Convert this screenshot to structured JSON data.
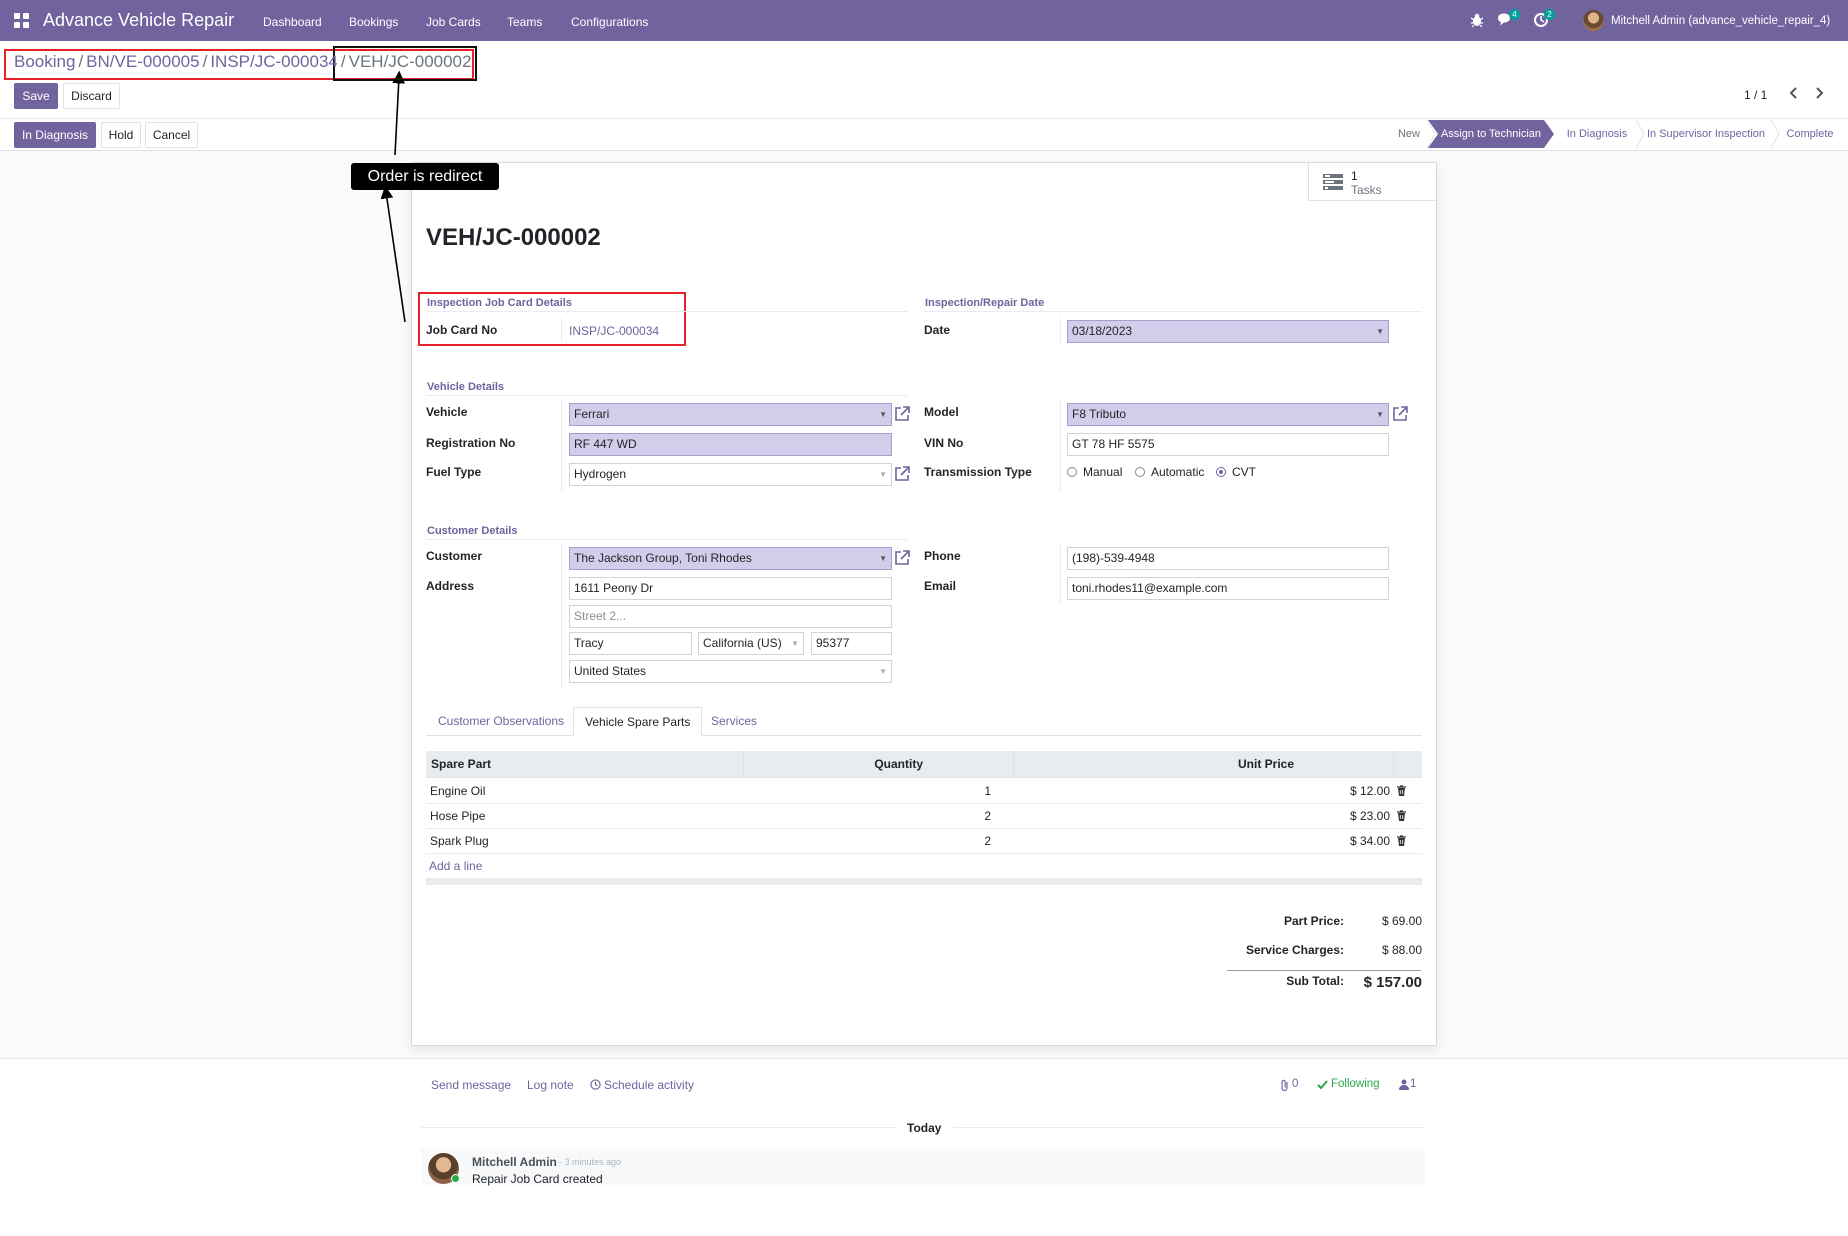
{
  "navbar": {
    "app_name": "Advance Vehicle Repair",
    "menu": [
      "Dashboard",
      "Bookings",
      "Job Cards",
      "Teams",
      "Configurations"
    ],
    "messages_badge": "4",
    "activities_badge": "2",
    "user": "Mitchell Admin (advance_vehicle_repair_4)"
  },
  "breadcrumb": {
    "items": [
      "Booking",
      "BN/VE-000005",
      "INSP/JC-000034"
    ],
    "current": "VEH/JC-000002"
  },
  "buttons": {
    "save": "Save",
    "discard": "Discard"
  },
  "pager": {
    "value": "1 / 1"
  },
  "actions": {
    "in_diagnosis": "In Diagnosis",
    "hold": "Hold",
    "cancel": "Cancel"
  },
  "stages": [
    "New",
    "Assign to Technician",
    "In Diagnosis",
    "In Supervisor Inspection",
    "Complete"
  ],
  "active_stage": "Assign to Technician",
  "annotation": {
    "tooltip": "Order is redirect"
  },
  "smart_button": {
    "count": "1",
    "label": "Tasks"
  },
  "record": {
    "title": "VEH/JC-000002",
    "inspection_group": "Inspection Job Card Details",
    "job_card_label": "Job Card No",
    "job_card_value": "INSP/JC-000034",
    "date_group": "Inspection/Repair Date",
    "date_label": "Date",
    "date_value": "03/18/2023",
    "vehicle_group": "Vehicle Details",
    "vehicle_label": "Vehicle",
    "vehicle_value": "Ferrari",
    "model_label": "Model",
    "model_value": "F8 Tributo",
    "reg_label": "Registration No",
    "reg_value": "RF 447 WD",
    "vin_label": "VIN No",
    "vin_value": "GT 78 HF 5575",
    "fuel_label": "Fuel Type",
    "fuel_value": "Hydrogen",
    "transmission_label": "Transmission Type",
    "transmission_options": [
      "Manual",
      "Automatic",
      "CVT"
    ],
    "transmission_selected": "CVT",
    "customer_group": "Customer Details",
    "customer_label": "Customer",
    "customer_value": "The Jackson Group, Toni Rhodes",
    "phone_label": "Phone",
    "phone_value": "(198)-539-4948",
    "address_label": "Address",
    "street": "1611 Peony Dr",
    "street2_placeholder": "Street 2...",
    "city": "Tracy",
    "state": "California (US)",
    "zip": "95377",
    "country": "United States",
    "email_label": "Email",
    "email_value": "toni.rhodes11@example.com"
  },
  "tabs": [
    "Customer Observations",
    "Vehicle Spare Parts",
    "Services"
  ],
  "active_tab": "Vehicle Spare Parts",
  "spare_parts": {
    "headers": [
      "Spare Part",
      "Quantity",
      "Unit Price"
    ],
    "rows": [
      {
        "part": "Engine Oil",
        "qty": "1",
        "price": "$ 12.00"
      },
      {
        "part": "Hose Pipe",
        "qty": "2",
        "price": "$ 23.00"
      },
      {
        "part": "Spark Plug",
        "qty": "2",
        "price": "$ 34.00"
      }
    ],
    "add_line": "Add a line"
  },
  "totals": {
    "part_price_label": "Part Price:",
    "part_price": "$ 69.00",
    "service_label": "Service Charges:",
    "service": "$ 88.00",
    "subtotal_label": "Sub Total:",
    "subtotal": "$ 157.00"
  },
  "chatter": {
    "send_message": "Send message",
    "log_note": "Log note",
    "schedule_activity": "Schedule activity",
    "attachments": "0",
    "following": "Following",
    "followers": "1",
    "date_separator": "Today",
    "message": {
      "author": "Mitchell Admin",
      "time": "- 3 minutes ago",
      "body": "Repair Job Card created"
    }
  },
  "colors": {
    "brand": "#71639e",
    "annotation_red": "#e8202a",
    "required_field": "#d2cdea"
  }
}
